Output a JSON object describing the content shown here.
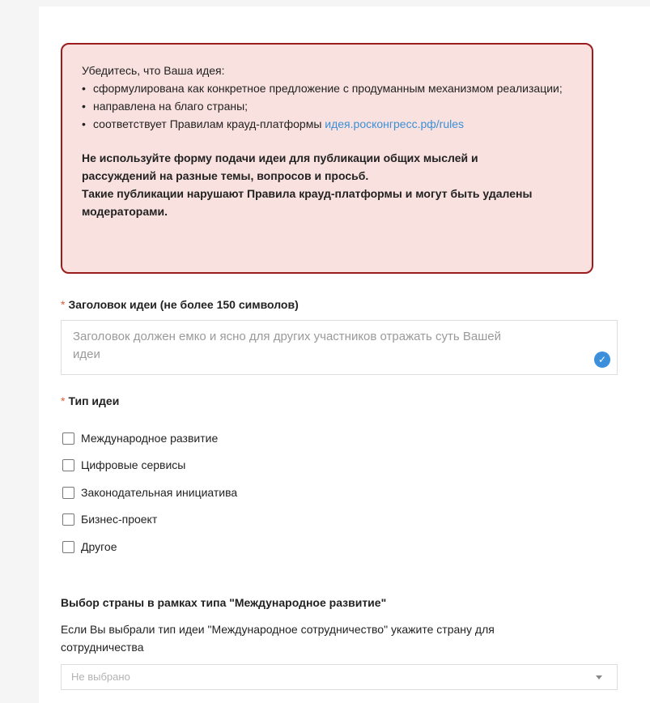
{
  "notice": {
    "intro": "Убедитесь, что Ваша идея:",
    "bullets": [
      "сформулирована как конкретное предложение с продуманным механизмом реализации;",
      "направлена на благо страны;",
      "соответствует Правилам крауд-платформы"
    ],
    "rules_link": "идея.росконгресс.рф/rules",
    "warning_lines": [
      "Не используйте форму подачи идеи для публикации общих мыслей и",
      "рассуждений на разные темы, вопросов и просьб.",
      "Такие публикации нарушают Правила крауд-платформы и могут быть удалены",
      "модераторами."
    ]
  },
  "title_field": {
    "label": "Заголовок идеи (не более 150 символов)",
    "placeholder_lines": [
      "Заголовок должен емко и ясно для других участников отражать суть Вашей",
      "идеи"
    ],
    "required_mark": "*"
  },
  "type_field": {
    "label": "Тип идеи",
    "required_mark": "*",
    "options": [
      "Международное развитие",
      "Цифровые сервисы",
      "Законодательная инициатива",
      "Бизнес-проект",
      "Другое"
    ]
  },
  "country_field": {
    "label": "Выбор страны в рамках типа \"Международное развитие\"",
    "help_lines": [
      "Если Вы выбрали тип идеи \"Международное сотрудничество\" укажите страну для",
      "сотрудничества"
    ],
    "selected": "Не выбрано"
  },
  "colors": {
    "notice_bg": "#f8e1df",
    "notice_border": "#9b1c1c",
    "link": "#3b8fd6",
    "required": "#e05a3a",
    "check_badge": "#3b8fdb"
  }
}
